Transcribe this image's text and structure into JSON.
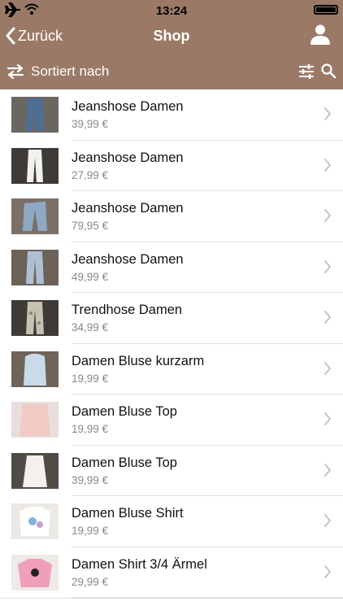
{
  "status_bar": {
    "time": "13:24"
  },
  "nav": {
    "back_label": "Zurück",
    "title": "Shop"
  },
  "toolbar": {
    "sort_label": "Sortiert nach"
  },
  "theme": {
    "header_color": "#9a7a66"
  },
  "products": [
    {
      "name": "Jeanshose Damen",
      "price": "39,99 €",
      "thumb": "jeans-dark"
    },
    {
      "name": "Jeanshose Damen",
      "price": "27,99 €",
      "thumb": "jeans-white"
    },
    {
      "name": "Jeanshose Damen",
      "price": "79,95 €",
      "thumb": "jeans-light"
    },
    {
      "name": "Jeanshose Damen",
      "price": "49,99 €",
      "thumb": "jeans-pale"
    },
    {
      "name": "Trendhose Damen",
      "price": "34,99 €",
      "thumb": "trousers-camo"
    },
    {
      "name": "Damen Bluse kurzarm",
      "price": "19,99 €",
      "thumb": "blouse-lightblue"
    },
    {
      "name": "Damen Bluse Top",
      "price": "19,99 €",
      "thumb": "top-pink"
    },
    {
      "name": "Damen Bluse Top",
      "price": "39,99 €",
      "thumb": "top-white"
    },
    {
      "name": "Damen Bluse Shirt",
      "price": "19,99 €",
      "thumb": "shirt-print"
    },
    {
      "name": "Damen Shirt 3/4 Ärmel",
      "price": "29,99 €",
      "thumb": "shirt-pink"
    }
  ]
}
